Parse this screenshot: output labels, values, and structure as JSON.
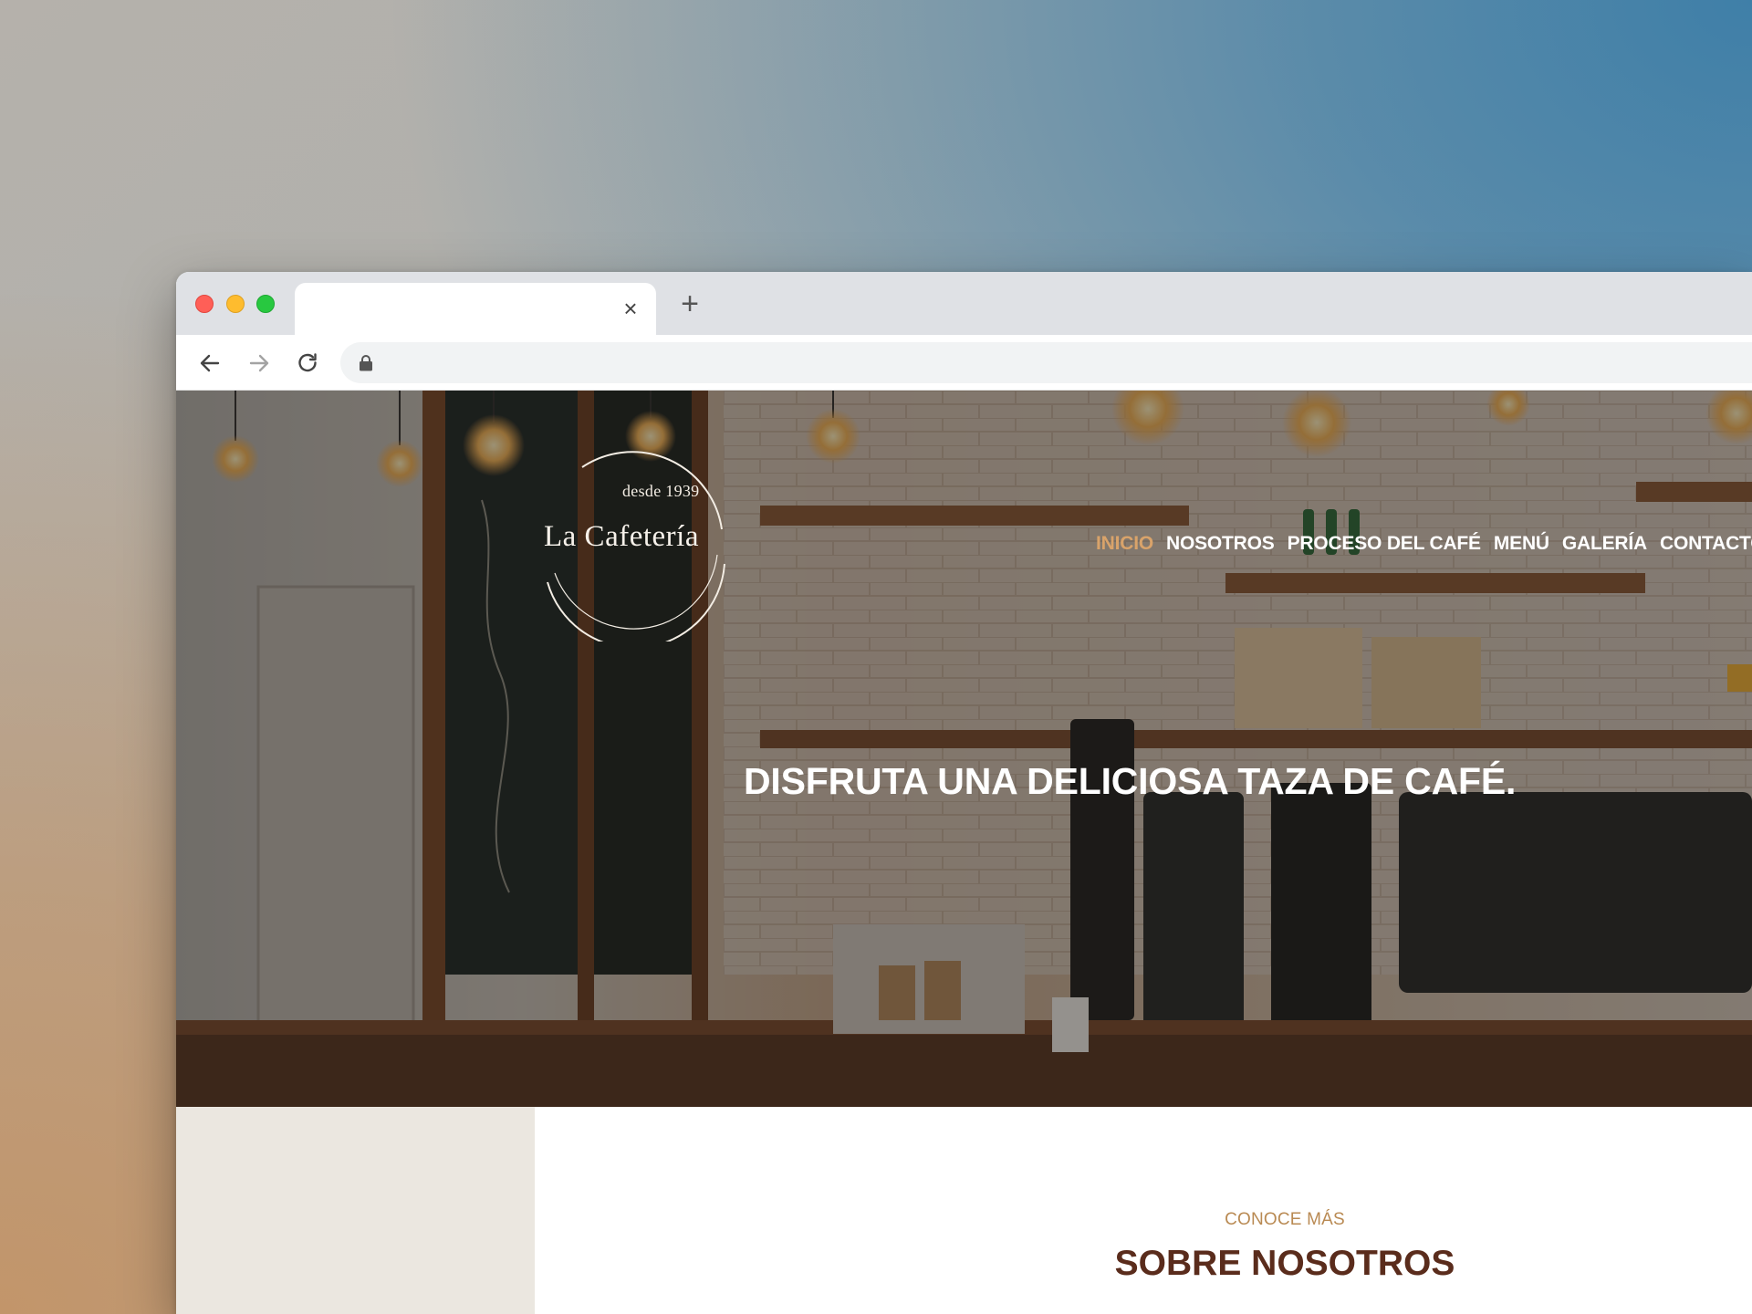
{
  "browser": {
    "tab_title": "",
    "url": "",
    "icons": {
      "close_tab": "close-icon",
      "new_tab": "plus-icon",
      "back": "arrow-left-icon",
      "forward": "arrow-right-icon",
      "reload": "reload-icon",
      "secure": "lock-icon"
    },
    "colors": {
      "chrome": "#dfe1e5",
      "close": "#ff5f57",
      "minimize": "#febc2e",
      "maximize": "#28c840"
    }
  },
  "site": {
    "logo": {
      "since": "desde 1939",
      "name": "La Cafetería"
    },
    "nav": [
      {
        "label": "INICIO",
        "active": true
      },
      {
        "label": "NOSOTROS",
        "active": false
      },
      {
        "label": "PROCESO DEL CAFÉ",
        "active": false
      },
      {
        "label": "MENÚ",
        "active": false
      },
      {
        "label": "GALERÍA",
        "active": false
      },
      {
        "label": "CONTACTO",
        "active": false
      }
    ],
    "hero": {
      "title": "DISFRUTA UNA DELICIOSA TAZA DE CAFÉ."
    },
    "about": {
      "eyebrow": "CONOCE MÁS",
      "title": "SOBRE NOSOTROS"
    },
    "colors": {
      "accent": "#d9a36a",
      "heading": "#5a2c1c",
      "eyebrow": "#b98a53",
      "side_panel": "#ebe7e0"
    }
  }
}
